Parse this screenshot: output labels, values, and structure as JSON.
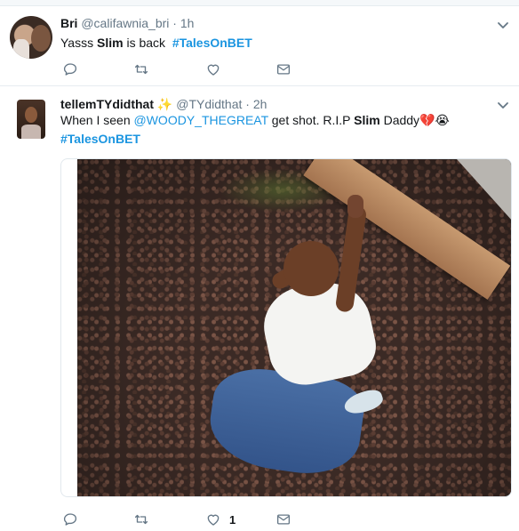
{
  "tweets": [
    {
      "name": "Bri",
      "handle": "@califawnia_bri",
      "separator": "·",
      "time": "1h",
      "text_pre": "Yasss ",
      "text_bold": "Slim",
      "text_mid": " is back  ",
      "hashtag": "#TalesOnBET",
      "like_count": ""
    },
    {
      "name": "tellemTYdidthat",
      "name_emoji": "✨",
      "handle": "@TYdidthat",
      "separator": "·",
      "time": "2h",
      "text_pre": "When I seen ",
      "mention": "@WOODY_THEGREAT",
      "text_mid": " get shot. R.I.P ",
      "text_bold": "Slim",
      "text_post": " Daddy",
      "emojis": "💔😭",
      "hashtag": "#TalesOnBET",
      "like_count": "1"
    }
  ],
  "icons": {
    "reply": "reply-icon",
    "retweet": "retweet-icon",
    "like": "heart-icon",
    "dm": "envelope-icon",
    "menu": "chevron-down-icon"
  },
  "colors": {
    "link": "#1b95e0",
    "muted": "#657786",
    "text": "#14171a"
  }
}
